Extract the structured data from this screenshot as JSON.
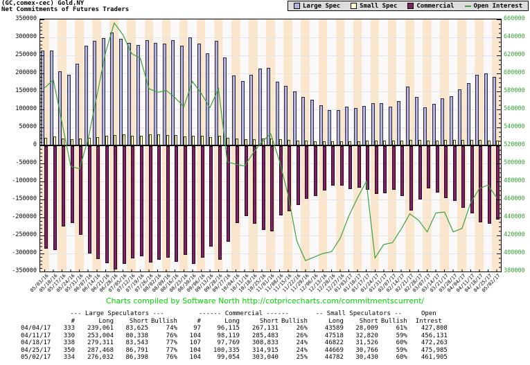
{
  "title": {
    "line1": "(GC,comex-cec) Gold,NY",
    "line2": "Net Commitments of Futures Traders"
  },
  "legend": [
    {
      "label": "Large Spec",
      "color": "#b3b3de",
      "type": "box"
    },
    {
      "label": "Small Spec",
      "color": "#ffffc8",
      "type": "box"
    },
    {
      "label": "Commercial",
      "color": "#7c2162",
      "type": "box"
    },
    {
      "label": "Open Interest",
      "color": "#3da03d",
      "type": "line"
    }
  ],
  "attribution": "Charts compiled by Software North  http://cotpricecharts.com/commitmentscurrent/",
  "colors": {
    "stripe_peach": "#fae6cd",
    "stripe_plain": "#f9f9f9",
    "grid": "#e3e3e3",
    "open_interest_line": "#3da03d",
    "right_axis_text": "#2fa32f",
    "attribution_green": "#00d800"
  },
  "chart_data": {
    "type": "bar",
    "title": "Net Commitments of Futures Traders (GC,comex-cec) Gold,NY",
    "categories": [
      "05/03/16",
      "05/10/16",
      "05/17/16",
      "05/24/16",
      "05/31/16",
      "06/07/16",
      "06/14/16",
      "06/21/16",
      "06/28/16",
      "07/05/16",
      "07/12/16",
      "07/19/16",
      "07/26/16",
      "08/02/16",
      "08/09/16",
      "08/16/16",
      "08/23/16",
      "08/30/16",
      "09/06/16",
      "09/13/16",
      "09/20/16",
      "09/27/16",
      "10/04/16",
      "10/11/16",
      "10/18/16",
      "10/25/16",
      "11/01/16",
      "11/08/16",
      "11/15/16",
      "11/22/16",
      "11/29/16",
      "12/06/16",
      "12/13/16",
      "12/20/16",
      "12/27/16",
      "01/03/17",
      "01/10/17",
      "01/17/17",
      "01/24/17",
      "01/31/17",
      "02/07/17",
      "02/14/17",
      "02/21/17",
      "02/28/17",
      "03/07/17",
      "03/14/17",
      "03/21/17",
      "03/28/17",
      "04/04/17",
      "04/11/17",
      "04/18/17",
      "04/25/17",
      "05/02/17"
    ],
    "series": [
      {
        "name": "Large Spec",
        "type": "bar",
        "axis": "left",
        "values": [
          264000,
          264000,
          205000,
          196000,
          227000,
          277000,
          290000,
          299000,
          314000,
          296000,
          285000,
          278000,
          292000,
          285000,
          282000,
          293000,
          276000,
          300000,
          283000,
          255000,
          290000,
          244000,
          195000,
          178000,
          197000,
          214000,
          216000,
          176000,
          165000,
          150000,
          134000,
          126000,
          112000,
          98000,
          98000,
          107000,
          104000,
          109000,
          118000,
          117000,
          108000,
          124000,
          163000,
          134000,
          105000,
          115000,
          130000,
          136000,
          155436,
          172666,
          195768,
          200677,
          189634
        ]
      },
      {
        "name": "Small Spec",
        "type": "bar",
        "axis": "left",
        "values": [
          21000,
          25000,
          19000,
          17000,
          19000,
          22000,
          24000,
          26000,
          29000,
          30000,
          27000,
          27000,
          31000,
          30000,
          28000,
          29000,
          25000,
          27000,
          26000,
          24000,
          26000,
          22000,
          19000,
          17000,
          18000,
          19000,
          20000,
          17000,
          16000,
          14000,
          13000,
          12000,
          12000,
          11000,
          11000,
          12000,
          12000,
          13000,
          14000,
          14000,
          13000,
          14000,
          16000,
          15000,
          13000,
          14000,
          15000,
          15000,
          15580,
          14698,
          15296,
          13903,
          14352
        ]
      },
      {
        "name": "Commercial",
        "type": "bar",
        "axis": "left",
        "values": [
          -285000,
          -289000,
          -224000,
          -213000,
          -246000,
          -299000,
          -314000,
          -325000,
          -343000,
          -326000,
          -312000,
          -305000,
          -323000,
          -315000,
          -310000,
          -322000,
          -301000,
          -327000,
          -309000,
          -279000,
          -316000,
          -266000,
          -214000,
          -195000,
          -215000,
          -233000,
          -236000,
          -193000,
          -181000,
          -164000,
          -147000,
          -138000,
          -124000,
          -109000,
          -109000,
          -119000,
          -116000,
          -122000,
          -132000,
          -131000,
          -121000,
          -138000,
          -179000,
          -149000,
          -118000,
          -129000,
          -145000,
          -151000,
          -171016,
          -187364,
          -211064,
          -214580,
          -203986
        ]
      },
      {
        "name": "Open Interest",
        "type": "line",
        "axis": "right",
        "values": [
          584000,
          593000,
          545000,
          497000,
          494000,
          527000,
          575000,
          623000,
          656000,
          643000,
          622000,
          617000,
          583000,
          579000,
          581000,
          573000,
          563000,
          591000,
          578000,
          562000,
          583000,
          502000,
          499000,
          497000,
          512000,
          524000,
          533000,
          503000,
          465000,
          414000,
          392000,
          396000,
          400000,
          402000,
          417000,
          442000,
          462000,
          480000,
          395000,
          410000,
          412000,
          427000,
          444000,
          437000,
          424000,
          445000,
          446000,
          424000,
          427808,
          456131,
          472263,
          475985,
          461905
        ]
      }
    ],
    "left_axis": {
      "min": -350000,
      "max": 350000,
      "step": 50000,
      "ticks": [
        "350000",
        "300000",
        "250000",
        "200000",
        "150000",
        "100000",
        "50000",
        "0",
        "-50000",
        "-100000",
        "-150000",
        "-200000",
        "-250000",
        "-300000",
        "-350000"
      ]
    },
    "right_axis": {
      "min": 380000,
      "max": 660000,
      "step": 20000,
      "ticks": [
        "660000",
        "640000",
        "620000",
        "600000",
        "580000",
        "560000",
        "540000",
        "520000",
        "500000",
        "480000",
        "460000",
        "440000",
        "420000",
        "400000",
        "380000"
      ]
    },
    "grid": true,
    "legend_position": "top-right"
  },
  "table": {
    "group_headers": [
      "--- Large Speculators ---",
      "------ Commercial ------",
      "-- Small Speculators --",
      "Open"
    ],
    "col_headers": [
      "",
      "#",
      "Long",
      "Short",
      "Bullish",
      "#",
      "Long",
      "Short",
      "Bullish",
      "Long",
      "Short",
      "Bullish",
      "Intrest"
    ],
    "rows": [
      [
        "04/04/17",
        "333",
        "239,061",
        "83,625",
        "74%",
        "97",
        "96,115",
        "267,131",
        "26%",
        "43589",
        "28,009",
        "61%",
        "427,808"
      ],
      [
        "04/11/17",
        "330",
        "253,004",
        "80,338",
        "76%",
        "104",
        "98,119",
        "285,483",
        "26%",
        "47518",
        "32,820",
        "59%",
        "456,131"
      ],
      [
        "04/18/17",
        "338",
        "279,311",
        "83,543",
        "77%",
        "107",
        "97,769",
        "308,833",
        "24%",
        "46822",
        "31,526",
        "60%",
        "472,263"
      ],
      [
        "04/25/17",
        "350",
        "287,468",
        "86,791",
        "77%",
        "104",
        "100,335",
        "314,915",
        "24%",
        "44669",
        "30,766",
        "59%",
        "475,985"
      ],
      [
        "05/02/17",
        "334",
        "276,032",
        "86,398",
        "76%",
        "104",
        "99,054",
        "303,040",
        "25%",
        "44782",
        "30,430",
        "60%",
        "461,905"
      ]
    ]
  }
}
